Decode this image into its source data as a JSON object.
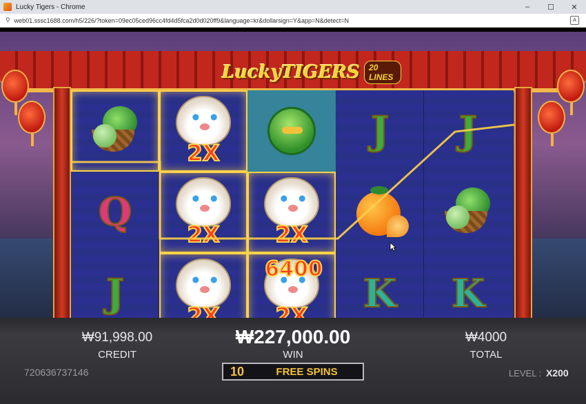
{
  "window": {
    "title": "Lucky Tigers - Chrome",
    "minimize": "–",
    "maximize": "☐",
    "close": "✕",
    "url": "web01.sssc1688.com/h5/226/?token=09ec05ced96cc4fd4d5fca2d0d020ff9&language=kr&dollarsign=Y&app=N&detect=N"
  },
  "game": {
    "logo": "LuckyTIGERS",
    "lines_badge": "20 LINES",
    "reels": [
      [
        "lettuce",
        "Q",
        "J"
      ],
      [
        "tiger",
        "tiger",
        "tiger"
      ],
      [
        "frog",
        "tiger",
        "tiger"
      ],
      [
        "J",
        "orange",
        "K"
      ],
      [
        "J",
        "lettuce",
        "K"
      ]
    ],
    "multipliers": {
      "reel2_row1": "2X",
      "reel2_row2": "2X",
      "reel2_row3": "2X",
      "reel3_row2": "2X",
      "reel3_row3": "2X"
    },
    "win_overlay": "6400",
    "colors": {
      "accent": "#f3c23a",
      "win_highlight": "#ffd24a",
      "reel_bg": "#2b3090"
    }
  },
  "hud": {
    "credit_value": "₩91,998.00",
    "credit_label": "CREDIT",
    "win_value": "₩227,000.00",
    "win_label": "WIN",
    "total_value": "₩4000",
    "total_label": "TOTAL",
    "session_id": "720636737146",
    "free_spins_count": "10",
    "free_spins_label": "FREE SPINS",
    "level_label": "LEVEL :",
    "level_value": "X200"
  }
}
